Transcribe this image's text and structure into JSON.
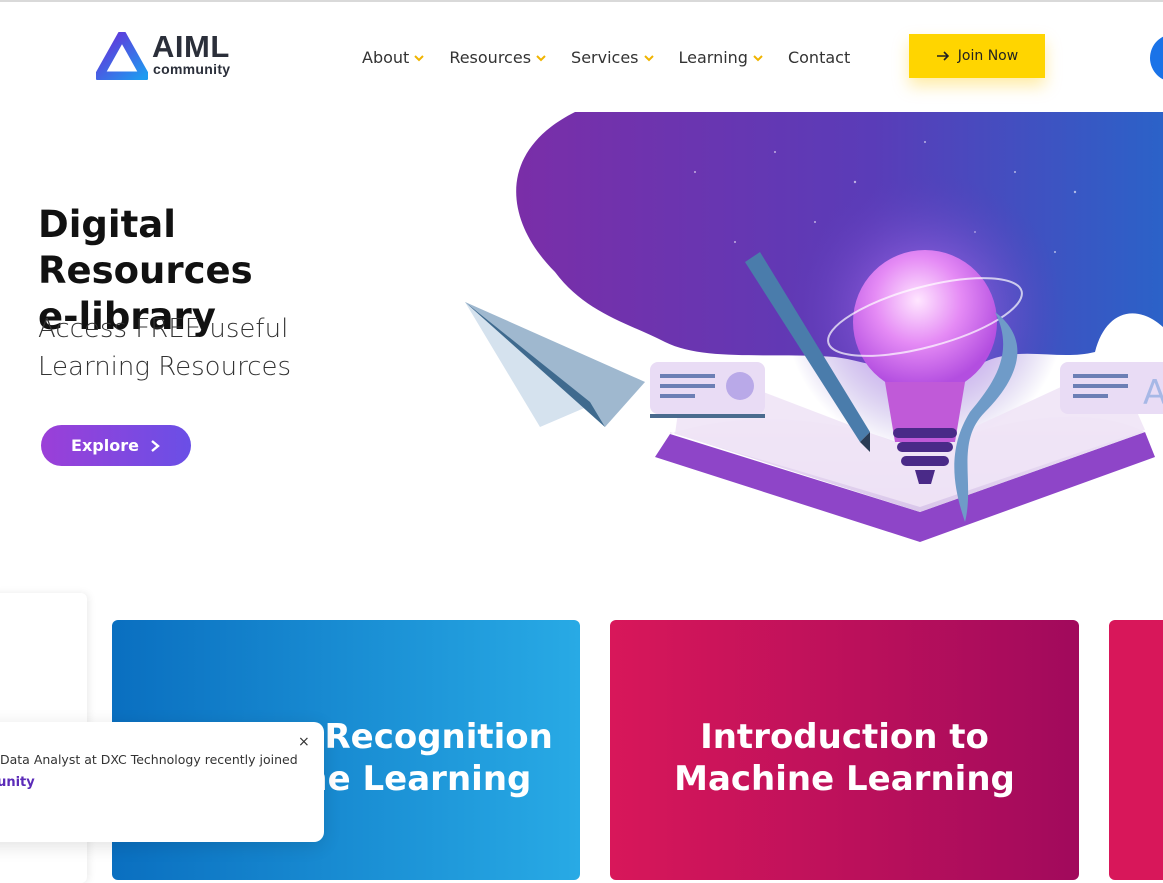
{
  "header": {
    "logo_title": "AIML",
    "logo_sub": "community",
    "nav": [
      {
        "label": "About",
        "icon": "chevron-down-icon"
      },
      {
        "label": "Resources",
        "icon": "chevron-down-icon"
      },
      {
        "label": "Services",
        "icon": "chevron-down-icon"
      },
      {
        "label": "Learning",
        "icon": "chevron-down-icon"
      },
      {
        "label": "Contact"
      }
    ],
    "join_label": "Join Now",
    "join_icon": "arrow-right-icon"
  },
  "hero": {
    "title_line1": "Digital Resources",
    "title_line2": "e-library",
    "sub_line1": "Access FREE useful",
    "sub_line2": "Learning Resources",
    "explore_label": "Explore",
    "explore_icon": "chevron-right-icon",
    "art_label": "A"
  },
  "cards": [
    {
      "line1": "Pattern Recognition",
      "line2": "Machine Learning"
    },
    {
      "line1": "Introduction to",
      "line2": "Machine Learning"
    }
  ],
  "toast": {
    "text": "Data Analyst at DXC Technology recently joined",
    "link": "mmunity",
    "close": "×"
  },
  "colors": {
    "accent_yellow": "#ffd500",
    "explore_purple": "#8a45dc",
    "card_blue": "#0a6fc0",
    "card_pink": "#d8175a"
  }
}
